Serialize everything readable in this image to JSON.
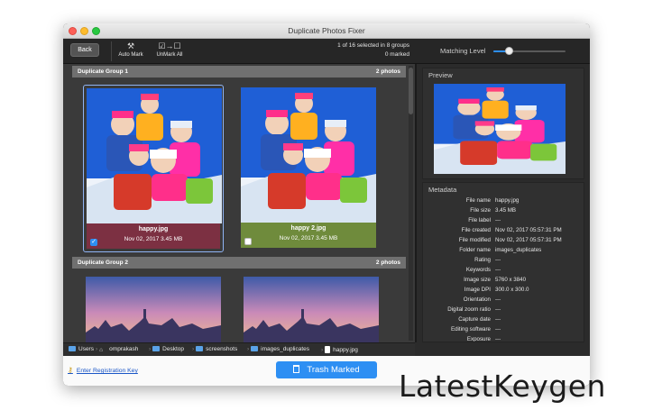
{
  "window": {
    "title": "Duplicate Photos Fixer"
  },
  "toolbar": {
    "back_label": "Back",
    "auto_mark_label": "Auto Mark",
    "unmark_all_label": "UnMark All",
    "selection_info": "1 of 16 selected in 8 groups",
    "marked_info": "0 marked",
    "matching_level_label": "Matching Level",
    "matching_level_value": 0.2
  },
  "groups": [
    {
      "title": "Duplicate Group 1",
      "count_label": "2 photos",
      "photos": [
        {
          "name": "happy.jpg",
          "meta": "Nov 02, 2017  3.45 MB",
          "checked": true,
          "highlight": "#7c3042"
        },
        {
          "name": "happy 2.jpg",
          "meta": "Nov 02, 2017  3.45 MB",
          "checked": false,
          "highlight": "#6f8b3c"
        }
      ]
    },
    {
      "title": "Duplicate Group 2",
      "count_label": "2 photos"
    }
  ],
  "preview": {
    "label": "Preview"
  },
  "metadata": {
    "label": "Metadata",
    "rows": [
      {
        "key": "File name",
        "value": "happy.jpg"
      },
      {
        "key": "File size",
        "value": "3.45 MB"
      },
      {
        "key": "File label",
        "value": "---"
      },
      {
        "key": "File created",
        "value": "Nov 02, 2017 05:57:31 PM"
      },
      {
        "key": "File modified",
        "value": "Nov 02, 2017 05:57:31 PM"
      },
      {
        "key": "Folder name",
        "value": "images_duplicates"
      },
      {
        "key": "Rating",
        "value": "---"
      },
      {
        "key": "Keywords",
        "value": "---"
      },
      {
        "key": "Image size",
        "value": "5760 x 3840"
      },
      {
        "key": "Image DPI",
        "value": "300.0 x 300.0"
      },
      {
        "key": "Orientation",
        "value": "---"
      },
      {
        "key": "Digital zoom ratio",
        "value": "---"
      },
      {
        "key": "Capture date",
        "value": "---"
      },
      {
        "key": "Editing software",
        "value": "---"
      },
      {
        "key": "Exposure",
        "value": "---"
      }
    ]
  },
  "path": [
    "Users",
    "omprakash",
    "Desktop",
    "screenshots",
    "images_duplicates",
    "happy.jpg"
  ],
  "status": {
    "registration_link": "Enter Registration Key",
    "trash_button": "Trash Marked"
  },
  "watermark": "LatestKeygen",
  "colors": {
    "accent": "#2d8ff3",
    "marked_caption": "#7c3042",
    "unmarked_caption": "#6f8b3c"
  }
}
